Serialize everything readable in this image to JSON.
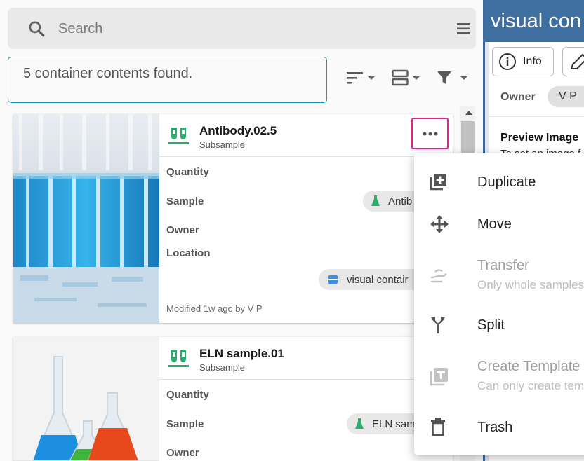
{
  "search": {
    "placeholder": "Search"
  },
  "results": {
    "summary": "5 container contents found."
  },
  "cards": [
    {
      "title": "Antibody.02.5",
      "subtitle": "Subsample",
      "fields": {
        "quantity": "Quantity",
        "sample": "Sample",
        "owner": "Owner",
        "location": "Location"
      },
      "sample_chip": "Antib",
      "location_chip": "visual contair",
      "modified": "Modified 1w ago by V P"
    },
    {
      "title": "ELN sample.01",
      "subtitle": "Subsample",
      "fields": {
        "quantity": "Quantity",
        "sample": "Sample",
        "owner": "Owner"
      },
      "sample_chip": "ELN sam"
    }
  ],
  "right_panel": {
    "header": "visual con",
    "info_label": "Info",
    "owner_label": "Owner",
    "owner_value": "V P",
    "preview_label": "Preview Image",
    "preview_text": "To set an image f"
  },
  "menu": {
    "items": [
      {
        "label": "Duplicate",
        "hint": "",
        "enabled": true
      },
      {
        "label": "Move",
        "hint": "",
        "enabled": true
      },
      {
        "label": "Transfer",
        "hint": "Only whole samples",
        "enabled": false
      },
      {
        "label": "Split",
        "hint": "",
        "enabled": true
      },
      {
        "label": "Create Template",
        "hint": "Can only create tem",
        "enabled": false
      },
      {
        "label": "Trash",
        "hint": "",
        "enabled": true
      }
    ]
  },
  "colors": {
    "accent": "#0d9fae",
    "highlight": "#ec1e8c",
    "header": "#3f6ea1",
    "subsample_icon": "#2bab6d"
  }
}
